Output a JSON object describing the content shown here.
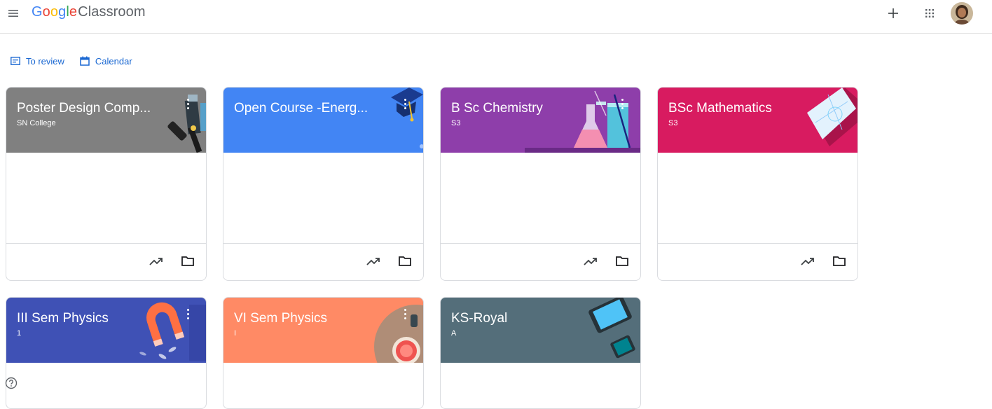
{
  "header": {
    "logo_google": [
      "G",
      "o",
      "o",
      "g",
      "l",
      "e"
    ],
    "logo_product": "Classroom"
  },
  "subnav": {
    "to_review": "To review",
    "calendar": "Calendar"
  },
  "classes": [
    {
      "title": "Poster Design Comp...",
      "section": "SN College",
      "color": "#808080",
      "illustration": "pen-design"
    },
    {
      "title": "Open Course -Energ...",
      "section": "",
      "color": "#4285f4",
      "illustration": "graduation-cap"
    },
    {
      "title": "B Sc Chemistry",
      "section": "S3",
      "color": "#8e3eaa",
      "illustration": "flask-beaker"
    },
    {
      "title": "BSc Mathematics",
      "section": "S3",
      "color": "#d81b60",
      "illustration": "geometry-tablet"
    },
    {
      "title": "III Sem Physics",
      "section": "1",
      "color": "#3f51b5",
      "illustration": "magnet"
    },
    {
      "title": "VI Sem Physics",
      "section": "I",
      "color": "#ff8a65",
      "illustration": "lab-dish"
    },
    {
      "title": "KS-Royal",
      "section": "A",
      "color": "#546e7a",
      "illustration": "devices"
    }
  ],
  "colors": {
    "accent": "#1967d2",
    "divider": "#dadce0"
  }
}
